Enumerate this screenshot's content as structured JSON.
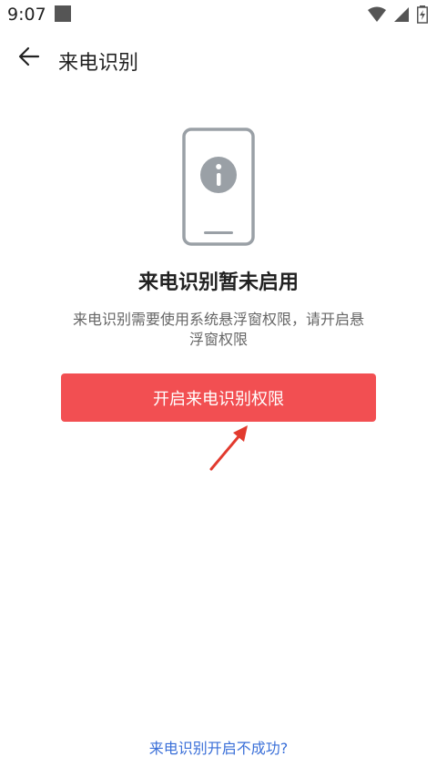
{
  "status_bar": {
    "time": "9:07"
  },
  "app_bar": {
    "title": "来电识别"
  },
  "main": {
    "heading": "来电识别暂未启用",
    "description": "来电识别需要使用系统悬浮窗权限，请开启悬浮窗权限",
    "primary_button_label": "开启来电识别权限",
    "help_link_label": "来电识别开启不成功?"
  },
  "icons": {
    "back": "arrow-left-icon",
    "illustration": "phone-info-icon",
    "annotation": "red-arrow-icon",
    "wifi": "wifi-icon",
    "signal": "signal-icon",
    "battery": "battery-icon"
  },
  "colors": {
    "accent": "#f24f52",
    "link": "#3a6fd8",
    "illustration": "#9aa0a6"
  }
}
